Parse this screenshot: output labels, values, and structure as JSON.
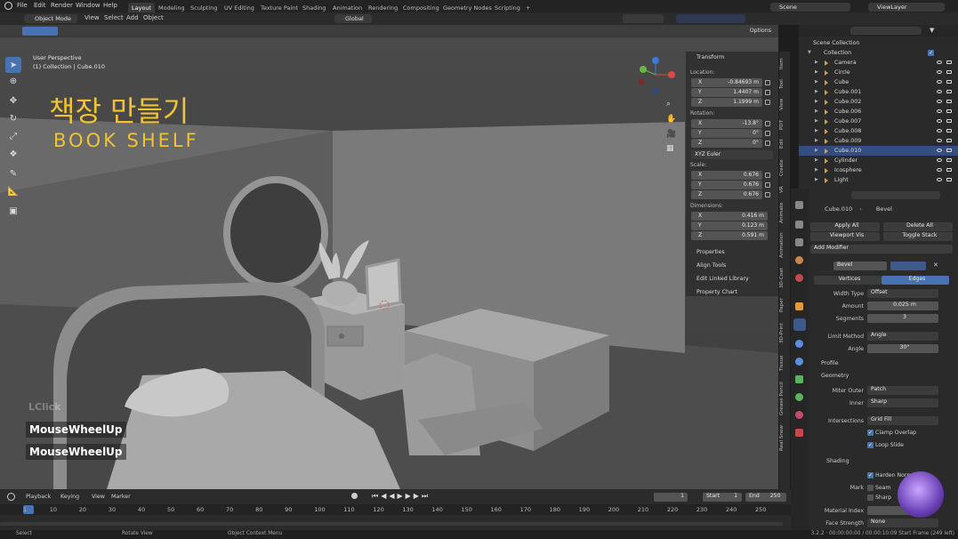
{
  "menubar": {
    "items": [
      "File",
      "Edit",
      "Render",
      "Window",
      "Help"
    ],
    "workspaces": [
      "Layout",
      "Modeling",
      "Sculpting",
      "UV Editing",
      "Texture Paint",
      "Shading",
      "Animation",
      "Rendering",
      "Compositing",
      "Geometry Nodes",
      "Scripting"
    ],
    "add_tab": "+",
    "scene": "Scene",
    "view_layer": "ViewLayer"
  },
  "viewport_header": {
    "mode": "Object Mode",
    "menus": [
      "View",
      "Select",
      "Add",
      "Object"
    ],
    "orientation": "Global",
    "options": "Options"
  },
  "viewport": {
    "perspective": "User Perspective",
    "collection_info": "(1) Collection | Cube.010",
    "title_korean": "책장 만들기",
    "title_english": "BOOK SHELF",
    "keys": [
      "LClick",
      "MouseWheelUp",
      "MouseWheelUp"
    ]
  },
  "npanel": {
    "title": "Transform",
    "location_label": "Location:",
    "location": [
      {
        "axis": "X",
        "value": "-0.84693 m"
      },
      {
        "axis": "Y",
        "value": "1.4407 m"
      },
      {
        "axis": "Z",
        "value": "1.1999 m"
      }
    ],
    "rotation_label": "Rotation:",
    "rotation": [
      {
        "axis": "X",
        "value": "-13.8°"
      },
      {
        "axis": "Y",
        "value": "0°"
      },
      {
        "axis": "Z",
        "value": "0°"
      }
    ],
    "rotation_mode": "XYZ Euler",
    "scale_label": "Scale:",
    "scale": [
      {
        "axis": "X",
        "value": "0.676"
      },
      {
        "axis": "Y",
        "value": "0.676"
      },
      {
        "axis": "Z",
        "value": "0.676"
      }
    ],
    "dimensions_label": "Dimensions:",
    "dimensions": [
      {
        "axis": "X",
        "value": "0.416 m"
      },
      {
        "axis": "Y",
        "value": "0.123 m"
      },
      {
        "axis": "Z",
        "value": "0.591 m"
      }
    ],
    "sections": [
      "Properties",
      "Align Tools",
      "Edit Linked Library",
      "Property Chart"
    ]
  },
  "side_tabs": [
    "Item",
    "Tool",
    "View",
    "PDT",
    "Edit",
    "Create",
    "VR",
    "Animate",
    "Animation",
    "3D-Coat",
    "Paper",
    "3D-Print",
    "Tissue",
    "Grease Pencil",
    "Real Snow"
  ],
  "outliner": {
    "root": "Scene Collection",
    "collection": "Collection",
    "items": [
      "Camera",
      "Circle",
      "Cube",
      "Cube.001",
      "Cube.002",
      "Cube.006",
      "Cube.007",
      "Cube.008",
      "Cube.009",
      "Cube.010",
      "Cylinder",
      "Icosphere",
      "Light"
    ],
    "selected": "Cube.010"
  },
  "properties": {
    "object": "Cube.010",
    "modifier": "Bevel",
    "apply_all": "Apply All",
    "delete_all": "Delete All",
    "viewport_vis": "Viewport Vis",
    "toggle_stack": "Toggle Stack",
    "add_modifier": "Add Modifier",
    "modifier_name": "Bevel",
    "tabs": [
      "Vertices",
      "Edges"
    ],
    "active_tab": "Edges",
    "fields": [
      {
        "label": "Width Type",
        "value": "Offset"
      },
      {
        "label": "Amount",
        "value": "0.025 m"
      },
      {
        "label": "Segments",
        "value": "3"
      },
      {
        "label": "Limit Method",
        "value": "Angle"
      },
      {
        "label": "Angle",
        "value": "30°"
      }
    ],
    "profile": "Profile",
    "geometry": "Geometry",
    "geom_fields": [
      {
        "label": "Miter Outer",
        "value": "Patch"
      },
      {
        "label": "Inner",
        "value": "Sharp"
      },
      {
        "label": "Intersections",
        "value": "Grid Fill"
      }
    ],
    "clamp_overlap": "Clamp Overlap",
    "loop_slide": "Loop Slide",
    "shading": "Shading",
    "harden_normals": "Harden Norm",
    "mark": "Mark",
    "seam": "Seam",
    "sharp": "Sharp",
    "material_index": "Material Index",
    "face_strength": "Face Strength",
    "face_strength_value": "None"
  },
  "timeline": {
    "menus": [
      "Playback",
      "Keying",
      "View",
      "Marker"
    ],
    "current_frame": "1",
    "start_label": "Start",
    "start": "1",
    "end_label": "End",
    "end": "250",
    "ticks": [
      "1",
      "10",
      "20",
      "30",
      "40",
      "50",
      "60",
      "70",
      "80",
      "90",
      "100",
      "110",
      "120",
      "130",
      "140",
      "150",
      "160",
      "170",
      "180",
      "190",
      "200",
      "210",
      "220",
      "230",
      "240",
      "250"
    ]
  },
  "statusbar": {
    "select": "Select",
    "rotate": "Rotate View",
    "context": "Object Context Menu",
    "info": "3.2.2 · 00:00:00:00 / 00:00:10:09 Start Frame (249 left)"
  }
}
